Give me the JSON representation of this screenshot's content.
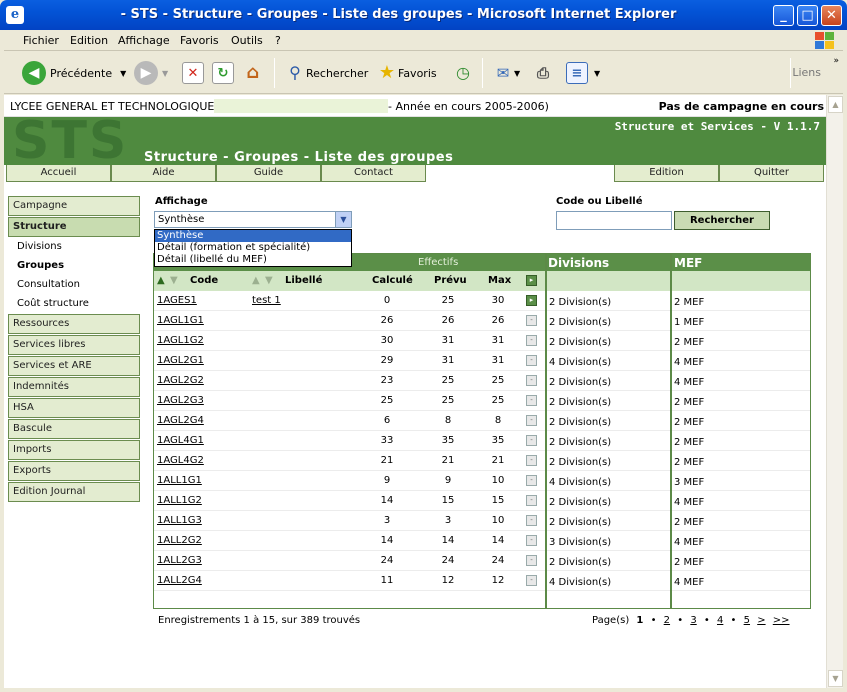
{
  "window": {
    "title": "- STS - Structure - Groupes - Liste des groupes - Microsoft Internet Explorer",
    "min": "_",
    "max": "□",
    "close": "✕"
  },
  "menu": [
    "Fichier",
    "Edition",
    "Affichage",
    "Favoris",
    "Outils",
    "?"
  ],
  "toolbar": {
    "back": "Précédente",
    "search": "Rechercher",
    "favorites": "Favoris",
    "links": "Liens"
  },
  "topline": {
    "lycee": "LYCEE GENERAL ET TECHNOLOGIQUE",
    "annee": "- Année en cours 2005-2006)",
    "campagne": "Pas de campagne en cours"
  },
  "banner": {
    "logo": "STS",
    "version": "Structure et Services - V 1.1.7",
    "page_title": "Structure - Groupes - Liste des groupes"
  },
  "nav": [
    "Accueil",
    "Aide",
    "Guide",
    "Contact",
    "Edition",
    "Quitter"
  ],
  "sidebar": {
    "campagne": "Campagne",
    "structure": "Structure",
    "sub": [
      "Divisions",
      "Groupes",
      "Consultation",
      "Coût structure"
    ],
    "items": [
      "Ressources",
      "Services libres",
      "Services et ARE",
      "Indemnités",
      "HSA",
      "Bascule",
      "Imports",
      "Exports",
      "Edition Journal"
    ]
  },
  "filters": {
    "affichage_label": "Affichage",
    "affichage_value": "Synthèse",
    "options": [
      "Synthèse",
      "Détail (formation et spécialité)",
      "Détail (libellé du MEF)"
    ],
    "code_label": "Code ou Libellé",
    "search_button": "Rechercher"
  },
  "grid": {
    "effectifs": "Effectifs",
    "divisions": "Divisions",
    "mef": "MEF",
    "cols": {
      "code": "Code",
      "libelle": "Libellé",
      "calcule": "Calculé",
      "prevu": "Prévu",
      "max": "Max"
    },
    "rows": [
      {
        "code": "1AGES1",
        "libelle": "test 1",
        "calcule": "0",
        "prevu": "25",
        "max": "30",
        "div": "2 Division(s)",
        "mef": "2 MEF",
        "on": true
      },
      {
        "code": "1AGL1G1",
        "libelle": "",
        "calcule": "26",
        "prevu": "26",
        "max": "26",
        "div": "2 Division(s)",
        "mef": "1 MEF"
      },
      {
        "code": "1AGL1G2",
        "libelle": "",
        "calcule": "30",
        "prevu": "31",
        "max": "31",
        "div": "2 Division(s)",
        "mef": "2 MEF"
      },
      {
        "code": "1AGL2G1",
        "libelle": "",
        "calcule": "29",
        "prevu": "31",
        "max": "31",
        "div": "4 Division(s)",
        "mef": "4 MEF"
      },
      {
        "code": "1AGL2G2",
        "libelle": "",
        "calcule": "23",
        "prevu": "25",
        "max": "25",
        "div": "2 Division(s)",
        "mef": "4 MEF"
      },
      {
        "code": "1AGL2G3",
        "libelle": "",
        "calcule": "25",
        "prevu": "25",
        "max": "25",
        "div": "2 Division(s)",
        "mef": "2 MEF"
      },
      {
        "code": "1AGL2G4",
        "libelle": "",
        "calcule": "6",
        "prevu": "8",
        "max": "8",
        "div": "2 Division(s)",
        "mef": "2 MEF"
      },
      {
        "code": "1AGL4G1",
        "libelle": "",
        "calcule": "33",
        "prevu": "35",
        "max": "35",
        "div": "2 Division(s)",
        "mef": "2 MEF"
      },
      {
        "code": "1AGL4G2",
        "libelle": "",
        "calcule": "21",
        "prevu": "21",
        "max": "21",
        "div": "2 Division(s)",
        "mef": "2 MEF"
      },
      {
        "code": "1ALL1G1",
        "libelle": "",
        "calcule": "9",
        "prevu": "9",
        "max": "10",
        "div": "4 Division(s)",
        "mef": "3 MEF"
      },
      {
        "code": "1ALL1G2",
        "libelle": "",
        "calcule": "14",
        "prevu": "15",
        "max": "15",
        "div": "2 Division(s)",
        "mef": "4 MEF"
      },
      {
        "code": "1ALL1G3",
        "libelle": "",
        "calcule": "3",
        "prevu": "3",
        "max": "10",
        "div": "2 Division(s)",
        "mef": "2 MEF"
      },
      {
        "code": "1ALL2G2",
        "libelle": "",
        "calcule": "14",
        "prevu": "14",
        "max": "14",
        "div": "3 Division(s)",
        "mef": "4 MEF"
      },
      {
        "code": "1ALL2G3",
        "libelle": "",
        "calcule": "24",
        "prevu": "24",
        "max": "24",
        "div": "2 Division(s)",
        "mef": "2 MEF"
      },
      {
        "code": "1ALL2G4",
        "libelle": "",
        "calcule": "11",
        "prevu": "12",
        "max": "12",
        "div": "4 Division(s)",
        "mef": "4 MEF"
      }
    ]
  },
  "footer": {
    "records": "Enregistrements 1 à 15, sur 389 trouvés",
    "pages_label": "Page(s)",
    "pages": [
      "1",
      "•",
      "2",
      "•",
      "3",
      "•",
      "4",
      "•",
      "5",
      ">",
      ">>"
    ]
  }
}
